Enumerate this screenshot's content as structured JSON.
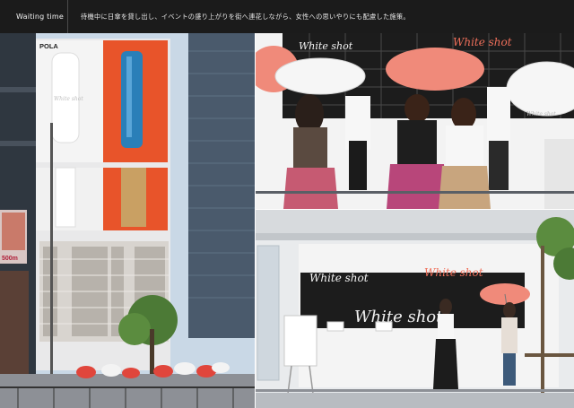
{
  "header": {
    "title": "Waiting time",
    "caption": "待機中に日傘を貸し出し、イベントの盛り上がりを街へ連花しながら、女性への思いやりにも配慮した施策。"
  },
  "photos": {
    "left": {
      "billboard_brand": "POLA",
      "tube_script": "White shot",
      "side_sign": "500m"
    },
    "top_right": {
      "sign_script_left": "White shot",
      "sign_script_right": "White shot",
      "umbrella_script": "White shot"
    },
    "bottom_right": {
      "sign_script_left": "White shot",
      "sign_script_right": "White shot",
      "board_script": "White shot"
    }
  },
  "colors": {
    "header_bg": "#1b1b1b",
    "billboard_orange": "#e8542a",
    "tube_blue": "#2a7fb8",
    "umbrella_pink": "#f08a7a",
    "skirt_magenta": "#b8467a"
  }
}
